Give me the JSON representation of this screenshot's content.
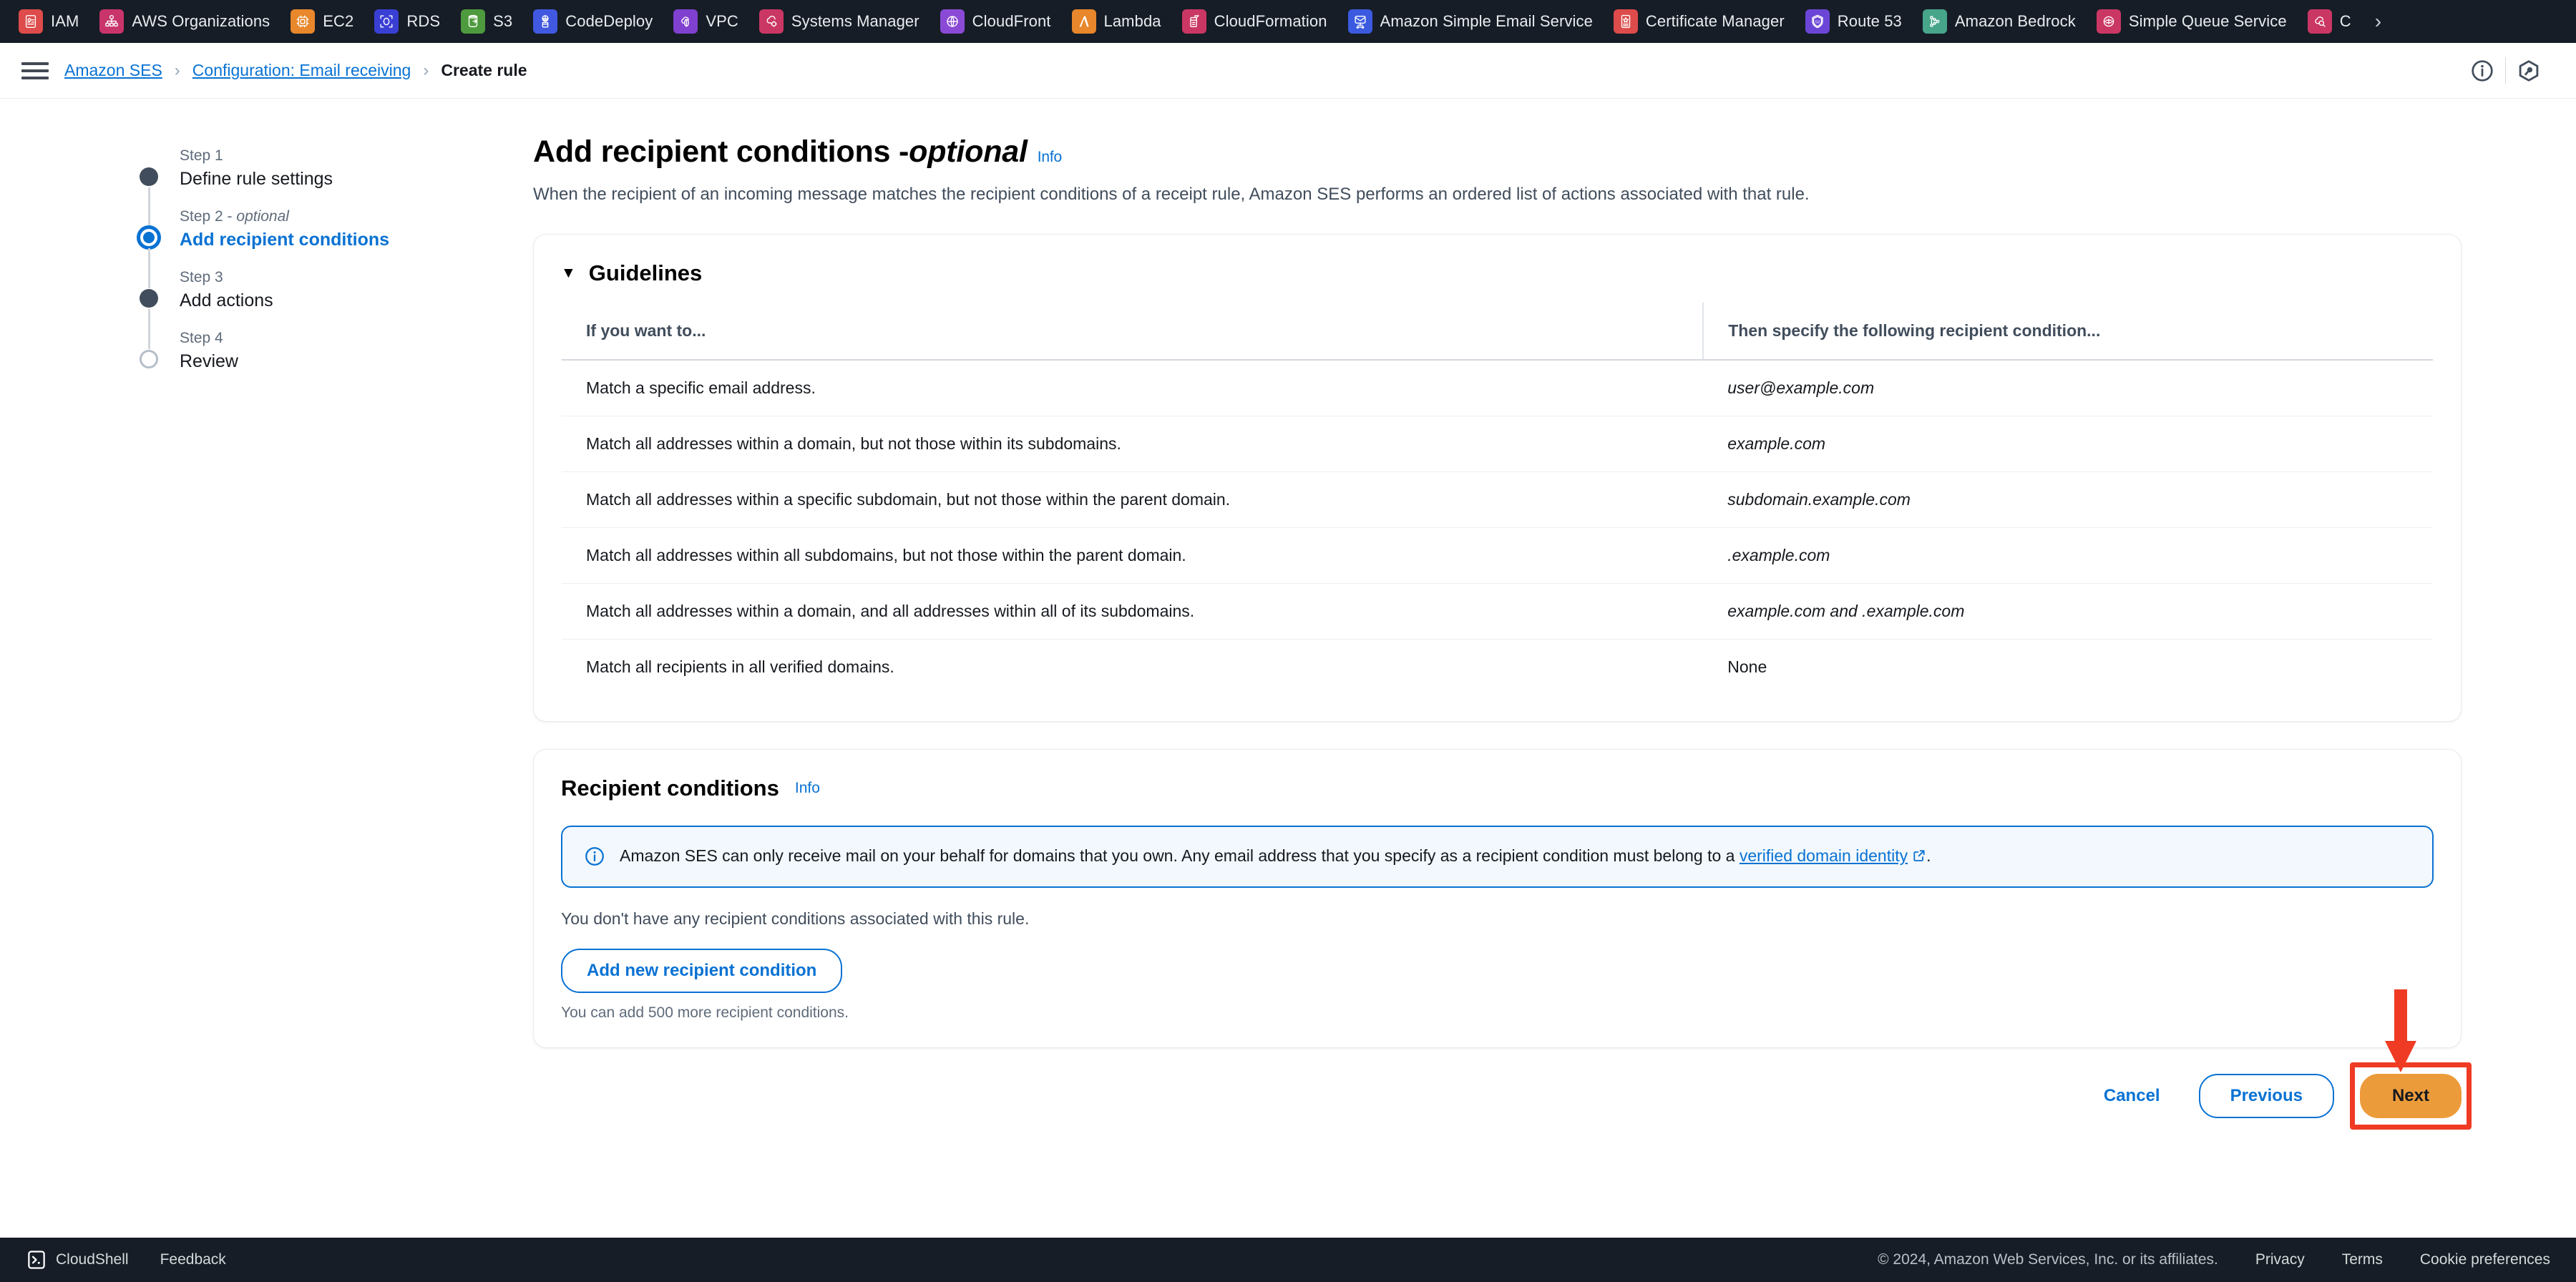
{
  "service_bar": {
    "items": [
      {
        "label": "IAM",
        "icon": "iam-icon",
        "color": "#dd4b4b"
      },
      {
        "label": "AWS Organizations",
        "icon": "organizations-icon",
        "color": "#c9356b"
      },
      {
        "label": "EC2",
        "icon": "ec2-icon",
        "color": "#e8872b"
      },
      {
        "label": "RDS",
        "icon": "rds-icon",
        "color": "#3a3fd4"
      },
      {
        "label": "S3",
        "icon": "s3-icon",
        "color": "#4e9a3e"
      },
      {
        "label": "CodeDeploy",
        "icon": "codedeploy-icon",
        "color": "#4159e0"
      },
      {
        "label": "VPC",
        "icon": "vpc-icon",
        "color": "#8040d0"
      },
      {
        "label": "Systems Manager",
        "icon": "systems-manager-icon",
        "color": "#cb3764"
      },
      {
        "label": "CloudFront",
        "icon": "cloudfront-icon",
        "color": "#8b4ad6"
      },
      {
        "label": "Lambda",
        "icon": "lambda-icon",
        "color": "#e8872b"
      },
      {
        "label": "CloudFormation",
        "icon": "cloudformation-icon",
        "color": "#cb3764"
      },
      {
        "label": "Amazon Simple Email Service",
        "icon": "ses-icon",
        "color": "#3b5ae0"
      },
      {
        "label": "Certificate Manager",
        "icon": "certificate-manager-icon",
        "color": "#dd4b4b"
      },
      {
        "label": "Route 53",
        "icon": "route53-icon",
        "color": "#6b46d6"
      },
      {
        "label": "Amazon Bedrock",
        "icon": "bedrock-icon",
        "color": "#47a58a"
      },
      {
        "label": "Simple Queue Service",
        "icon": "sqs-icon",
        "color": "#cb3764"
      },
      {
        "label": "C",
        "icon": "cloudwatch-icon",
        "color": "#cb3764"
      }
    ],
    "more_label": "›"
  },
  "breadcrumb": {
    "menu_icon": "hamburger-icon",
    "items": [
      {
        "label": "Amazon SES",
        "link": true
      },
      {
        "label": "Configuration: Email receiving",
        "link": true
      },
      {
        "label": "Create rule",
        "link": false
      }
    ],
    "separator": "›",
    "right_icons": [
      "info-circle-icon",
      "settings-hex-icon"
    ]
  },
  "wizard": {
    "steps": [
      {
        "label": "Step 1",
        "optional": "",
        "title": "Define rule settings",
        "state": "done"
      },
      {
        "label": "Step 2 - ",
        "optional": "optional",
        "title": "Add recipient conditions",
        "state": "current"
      },
      {
        "label": "Step 3",
        "optional": "",
        "title": "Add actions",
        "state": "done"
      },
      {
        "label": "Step 4",
        "optional": "",
        "title": "Review",
        "state": "pending"
      }
    ]
  },
  "main": {
    "title_main": "Add recipient conditions - ",
    "title_optional": "optional",
    "title_info": "Info",
    "description": "When the recipient of an incoming message matches the recipient conditions of a receipt rule, Amazon SES performs an ordered list of actions associated with that rule.",
    "guidelines": {
      "caret": "▼",
      "heading": "Guidelines",
      "columns": [
        "If you want to...",
        "Then specify the following recipient condition..."
      ],
      "rows": [
        {
          "want": "Match a specific email address.",
          "condition": "user@example.com",
          "italic": true
        },
        {
          "want": "Match all addresses within a domain, but not those within its subdomains.",
          "condition": "example.com",
          "italic": true
        },
        {
          "want": "Match all addresses within a specific subdomain, but not those within the parent domain.",
          "condition": "subdomain.example.com",
          "italic": true
        },
        {
          "want": "Match all addresses within all subdomains, but not those within the parent domain.",
          "condition": ".example.com",
          "italic": true
        },
        {
          "want": "Match all addresses within a domain, and all addresses within all of its subdomains.",
          "condition": "example.com and .example.com",
          "italic": true
        },
        {
          "want": "Match all recipients in all verified domains.",
          "condition": "None",
          "italic": false
        }
      ]
    },
    "recipient_conditions": {
      "heading": "Recipient conditions",
      "info": "Info",
      "alert_icon": "info-circle-icon",
      "alert_text_before": "Amazon SES can only receive mail on your behalf for domains that you own. Any email address that you specify as a recipient condition must belong to a ",
      "alert_link": "verified domain identity",
      "alert_link_icon": "external-link-icon",
      "alert_text_after": ".",
      "empty_message": "You don't have any recipient conditions associated with this rule.",
      "add_button": "Add new recipient condition",
      "hint": "You can add 500 more recipient conditions."
    },
    "actions": {
      "cancel": "Cancel",
      "previous": "Previous",
      "next": "Next",
      "highlight_color": "#ef3b24",
      "next_bg": "#ec9b3b",
      "annotation": "red-arrow-pointing-to-next-button"
    }
  },
  "footer": {
    "cloudshell_icon": "cloudshell-icon",
    "cloudshell": "CloudShell",
    "feedback": "Feedback",
    "copyright": "© 2024, Amazon Web Services, Inc. or its affiliates.",
    "links": [
      "Privacy",
      "Terms",
      "Cookie preferences"
    ]
  }
}
